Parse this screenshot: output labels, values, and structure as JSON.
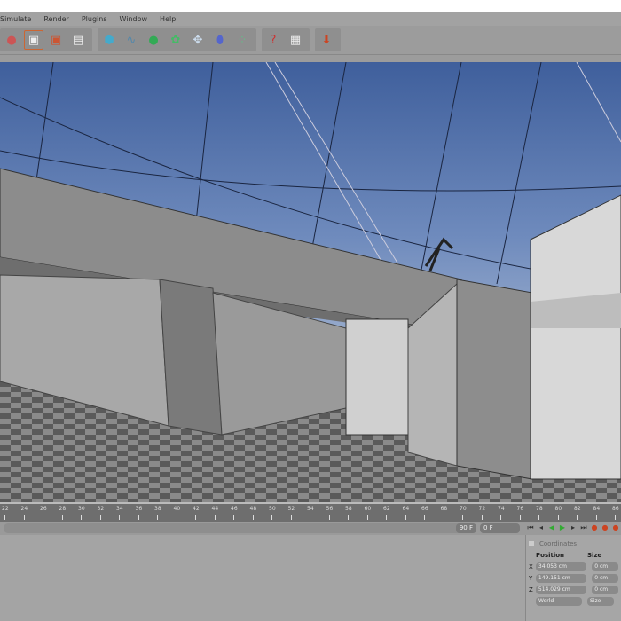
{
  "menu": [
    "Simulate",
    "Render",
    "Plugins",
    "Window",
    "Help"
  ],
  "toolbar_icons": [
    "render-view-icon",
    "render-active-icon",
    "render-picture-viewer-icon",
    "render-settings-icon",
    "cube-icon",
    "spline-icon",
    "nurbs-icon",
    "array-icon",
    "deformer-icon",
    "scene-icon",
    "particles-icon",
    "help-cursor-icon",
    "layout-icon",
    "import-icon"
  ],
  "timeline": {
    "start": 22,
    "step": 2,
    "end": 86
  },
  "controls": {
    "end_frame": "90 F",
    "current_frame": "0 F"
  },
  "coordinates": {
    "title": "Coordinates",
    "position_label": "Position",
    "size_label": "Size",
    "rows": [
      {
        "axis": "X",
        "pos": "34.053 cm",
        "size": "0 cm"
      },
      {
        "axis": "Y",
        "pos": "149.151 cm",
        "size": "0 cm"
      },
      {
        "axis": "Z",
        "pos": "514.029 cm",
        "size": "0 cm"
      }
    ],
    "mode": "World",
    "size_mode": "Size"
  },
  "colors": {
    "sky_top": "#3e5f9e",
    "sky_bottom": "#8fa6c9",
    "ui": "#a0a0a0"
  }
}
